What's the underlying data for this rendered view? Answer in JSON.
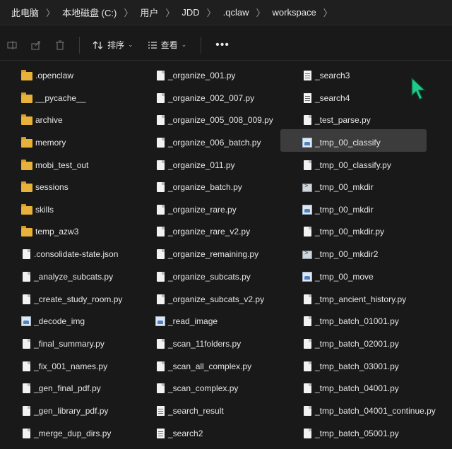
{
  "breadcrumb": [
    "此电脑",
    "本地磁盘 (C:)",
    "用户",
    "JDD",
    ".qclaw",
    "workspace"
  ],
  "toolbar": {
    "sort_label": "排序",
    "view_label": "查看",
    "more_label": "•••"
  },
  "columns": [
    [
      {
        "name": ".openclaw",
        "type": "folder"
      },
      {
        "name": "__pycache__",
        "type": "folder"
      },
      {
        "name": "archive",
        "type": "folder"
      },
      {
        "name": "memory",
        "type": "folder"
      },
      {
        "name": "mobi_test_out",
        "type": "folder"
      },
      {
        "name": "sessions",
        "type": "folder"
      },
      {
        "name": "skills",
        "type": "folder"
      },
      {
        "name": "temp_azw3",
        "type": "folder"
      },
      {
        "name": ".consolidate-state.json",
        "type": "file"
      },
      {
        "name": "_analyze_subcats.py",
        "type": "file"
      },
      {
        "name": "_create_study_room.py",
        "type": "file"
      },
      {
        "name": "_decode_img",
        "type": "img"
      },
      {
        "name": "_final_summary.py",
        "type": "file"
      },
      {
        "name": "_fix_001_names.py",
        "type": "file"
      },
      {
        "name": "_gen_final_pdf.py",
        "type": "file"
      },
      {
        "name": "_gen_library_pdf.py",
        "type": "file"
      },
      {
        "name": "_merge_dup_dirs.py",
        "type": "file"
      }
    ],
    [
      {
        "name": "_organize_001.py",
        "type": "file"
      },
      {
        "name": "_organize_002_007.py",
        "type": "file"
      },
      {
        "name": "_organize_005_008_009.py",
        "type": "file"
      },
      {
        "name": "_organize_006_batch.py",
        "type": "file"
      },
      {
        "name": "_organize_011.py",
        "type": "file"
      },
      {
        "name": "_organize_batch.py",
        "type": "file"
      },
      {
        "name": "_organize_rare.py",
        "type": "file"
      },
      {
        "name": "_organize_rare_v2.py",
        "type": "file"
      },
      {
        "name": "_organize_remaining.py",
        "type": "file"
      },
      {
        "name": "_organize_subcats.py",
        "type": "file"
      },
      {
        "name": "_organize_subcats_v2.py",
        "type": "file"
      },
      {
        "name": "_read_image",
        "type": "img"
      },
      {
        "name": "_scan_11folders.py",
        "type": "file"
      },
      {
        "name": "_scan_all_complex.py",
        "type": "file"
      },
      {
        "name": "_scan_complex.py",
        "type": "file"
      },
      {
        "name": "_search_result",
        "type": "doc"
      },
      {
        "name": "_search2",
        "type": "doc"
      }
    ],
    [
      {
        "name": "_search3",
        "type": "doc"
      },
      {
        "name": "_search4",
        "type": "doc"
      },
      {
        "name": "_test_parse.py",
        "type": "file"
      },
      {
        "name": "_tmp_00_classify",
        "type": "img"
      },
      {
        "name": "_tmp_00_classify.py",
        "type": "file"
      },
      {
        "name": "_tmp_00_mkdir",
        "type": "shell"
      },
      {
        "name": "_tmp_00_mkdir",
        "type": "img"
      },
      {
        "name": "_tmp_00_mkdir.py",
        "type": "file"
      },
      {
        "name": "_tmp_00_mkdir2",
        "type": "shell"
      },
      {
        "name": "_tmp_00_move",
        "type": "img"
      },
      {
        "name": "_tmp_ancient_history.py",
        "type": "file"
      },
      {
        "name": "_tmp_batch_01001.py",
        "type": "file"
      },
      {
        "name": "_tmp_batch_02001.py",
        "type": "file"
      },
      {
        "name": "_tmp_batch_03001.py",
        "type": "file"
      },
      {
        "name": "_tmp_batch_04001.py",
        "type": "file"
      },
      {
        "name": "_tmp_batch_04001_continue.py",
        "type": "file"
      },
      {
        "name": "_tmp_batch_05001.py",
        "type": "file"
      }
    ]
  ],
  "selected_item": "_search3"
}
